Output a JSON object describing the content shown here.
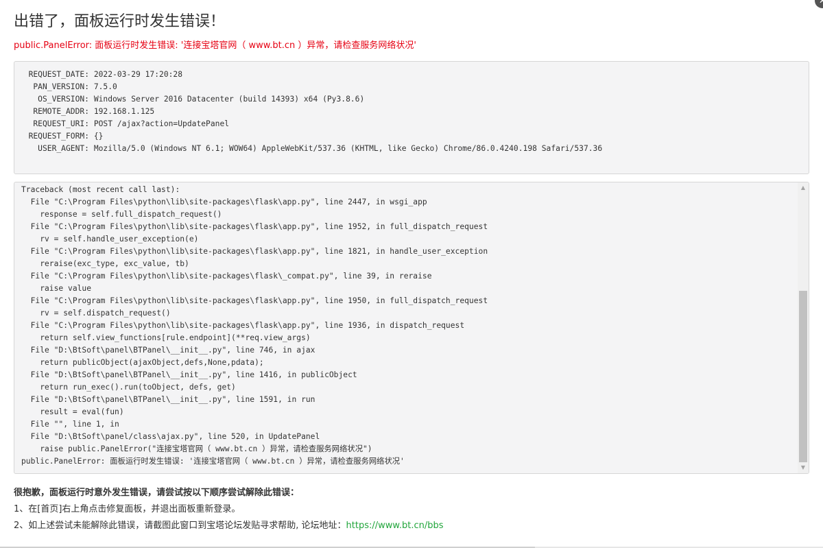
{
  "title": "出错了，面板运行时发生错误！",
  "error_line": "public.PanelError: 面板运行时发生错误: '连接宝塔官网（ www.bt.cn ）异常，请检查服务网络状况'",
  "request_info": [
    {
      "key": "REQUEST_DATE:",
      "value": "2022-03-29 17:20:28"
    },
    {
      "key": "PAN_VERSION:",
      "value": "7.5.0"
    },
    {
      "key": "OS_VERSION:",
      "value": "Windows Server 2016 Datacenter (build 14393) x64 (Py3.8.6)"
    },
    {
      "key": "REMOTE_ADDR:",
      "value": "192.168.1.125"
    },
    {
      "key": "REQUEST_URI:",
      "value": "POST /ajax?action=UpdatePanel"
    },
    {
      "key": "REQUEST_FORM:",
      "value": "{}"
    },
    {
      "key": "USER_AGENT:",
      "value": "Mozilla/5.0 (Windows NT 6.1; WOW64) AppleWebKit/537.36 (KHTML, like Gecko) Chrome/86.0.4240.198 Safari/537.36"
    }
  ],
  "traceback": [
    "Traceback (most recent call last):",
    "  File \"C:\\Program Files\\python\\lib\\site-packages\\flask\\app.py\", line 2447, in wsgi_app",
    "    response = self.full_dispatch_request()",
    "  File \"C:\\Program Files\\python\\lib\\site-packages\\flask\\app.py\", line 1952, in full_dispatch_request",
    "    rv = self.handle_user_exception(e)",
    "  File \"C:\\Program Files\\python\\lib\\site-packages\\flask\\app.py\", line 1821, in handle_user_exception",
    "    reraise(exc_type, exc_value, tb)",
    "  File \"C:\\Program Files\\python\\lib\\site-packages\\flask\\_compat.py\", line 39, in reraise",
    "    raise value",
    "  File \"C:\\Program Files\\python\\lib\\site-packages\\flask\\app.py\", line 1950, in full_dispatch_request",
    "    rv = self.dispatch_request()",
    "  File \"C:\\Program Files\\python\\lib\\site-packages\\flask\\app.py\", line 1936, in dispatch_request",
    "    return self.view_functions[rule.endpoint](**req.view_args)",
    "  File \"D:\\BtSoft\\panel\\BTPanel\\__init__.py\", line 746, in ajax",
    "    return publicObject(ajaxObject,defs,None,pdata);",
    "  File \"D:\\BtSoft\\panel\\BTPanel\\__init__.py\", line 1416, in publicObject",
    "    return run_exec().run(toObject, defs, get)",
    "  File \"D:\\BtSoft\\panel\\BTPanel\\__init__.py\", line 1591, in run",
    "    result = eval(fun)",
    "  File \"\", line 1, in",
    "  File \"D:\\BtSoft\\panel/class\\ajax.py\", line 520, in UpdatePanel",
    "    raise public.PanelError(\"连接宝塔官网（ www.bt.cn ）异常，请检查服务网络状况\")",
    "public.PanelError: 面板运行时发生错误: '连接宝塔官网（ www.bt.cn ）异常，请检查服务网络状况'"
  ],
  "help": {
    "title": "很抱歉，面板运行时意外发生错误，请尝试按以下顺序尝试解除此错误：",
    "step1": "1、在[首页]右上角点击修复面板，并退出面板重新登录。",
    "step2_text": "2、如上述尝试未能解除此错误，请截图此窗口到宝塔论坛发贴寻求帮助, 论坛地址：",
    "step2_link": "https://www.bt.cn/bbs"
  },
  "close_glyph": "✕",
  "scroll_up_glyph": "▲",
  "scroll_down_glyph": "▼",
  "colors": {
    "error_red": "#e60012",
    "link_green": "#20a53a"
  }
}
